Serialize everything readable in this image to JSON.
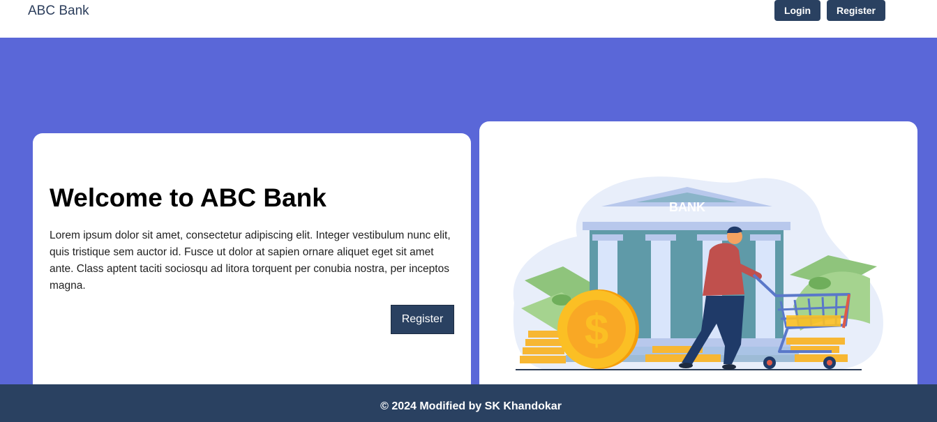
{
  "navbar": {
    "brand": "ABC Bank",
    "login_label": "Login",
    "register_label": "Register"
  },
  "hero": {
    "title": "Welcome to ABC Bank",
    "text": "Lorem ipsum dolor sit amet, consectetur adipiscing elit. Integer vestibulum nunc elit, quis tristique sem auctor id. Fusce ut dolor at sapien ornare aliquet eget sit amet ante. Class aptent taciti sociosqu ad litora torquent per conubia nostra, per inceptos magna.",
    "register_label": "Register"
  },
  "illustration": {
    "bank_sign": "BANK",
    "coin_symbol": "$"
  },
  "footer": {
    "text": "© 2024 Modified by SK Khandokar"
  },
  "colors": {
    "primary": "#2a4161",
    "background": "#5a67d8"
  }
}
